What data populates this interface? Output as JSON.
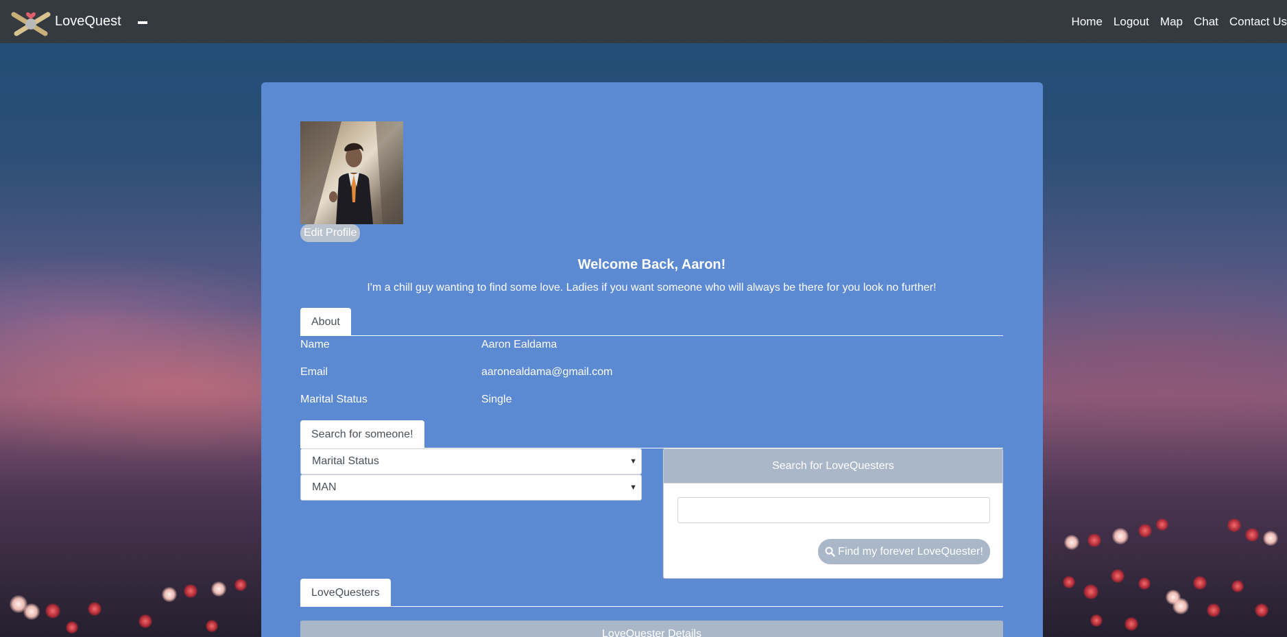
{
  "nav": {
    "brand": "LoveQuest",
    "links": [
      "Home",
      "Logout",
      "Map",
      "Chat",
      "Contact Us"
    ]
  },
  "profile": {
    "edit_label": "Edit Profile",
    "welcome": "Welcome Back, Aaron!",
    "bio": "I'm a chill guy wanting to find some love. Ladies if you want someone who will always be there for you look no further!"
  },
  "about": {
    "tab_label": "About",
    "rows": [
      {
        "key": "Name",
        "value": "Aaron Ealdama"
      },
      {
        "key": "Email",
        "value": "aaronealdama@gmail.com"
      },
      {
        "key": "Marital Status",
        "value": "Single"
      }
    ]
  },
  "search": {
    "tab_label": "Search for someone!",
    "marital_status_selected": "Marital Status",
    "gender_selected": "MAN",
    "panel_title": "Search for LoveQuesters",
    "input_value": "",
    "button_label": "Find my forever LoveQuester!"
  },
  "lovequesters": {
    "tab_label": "LoveQuesters",
    "details_header": "LoveQuester Details"
  },
  "colors": {
    "navbar": "#343a40",
    "card": "#5b89d2",
    "muted_button": "#a9b7c9"
  }
}
